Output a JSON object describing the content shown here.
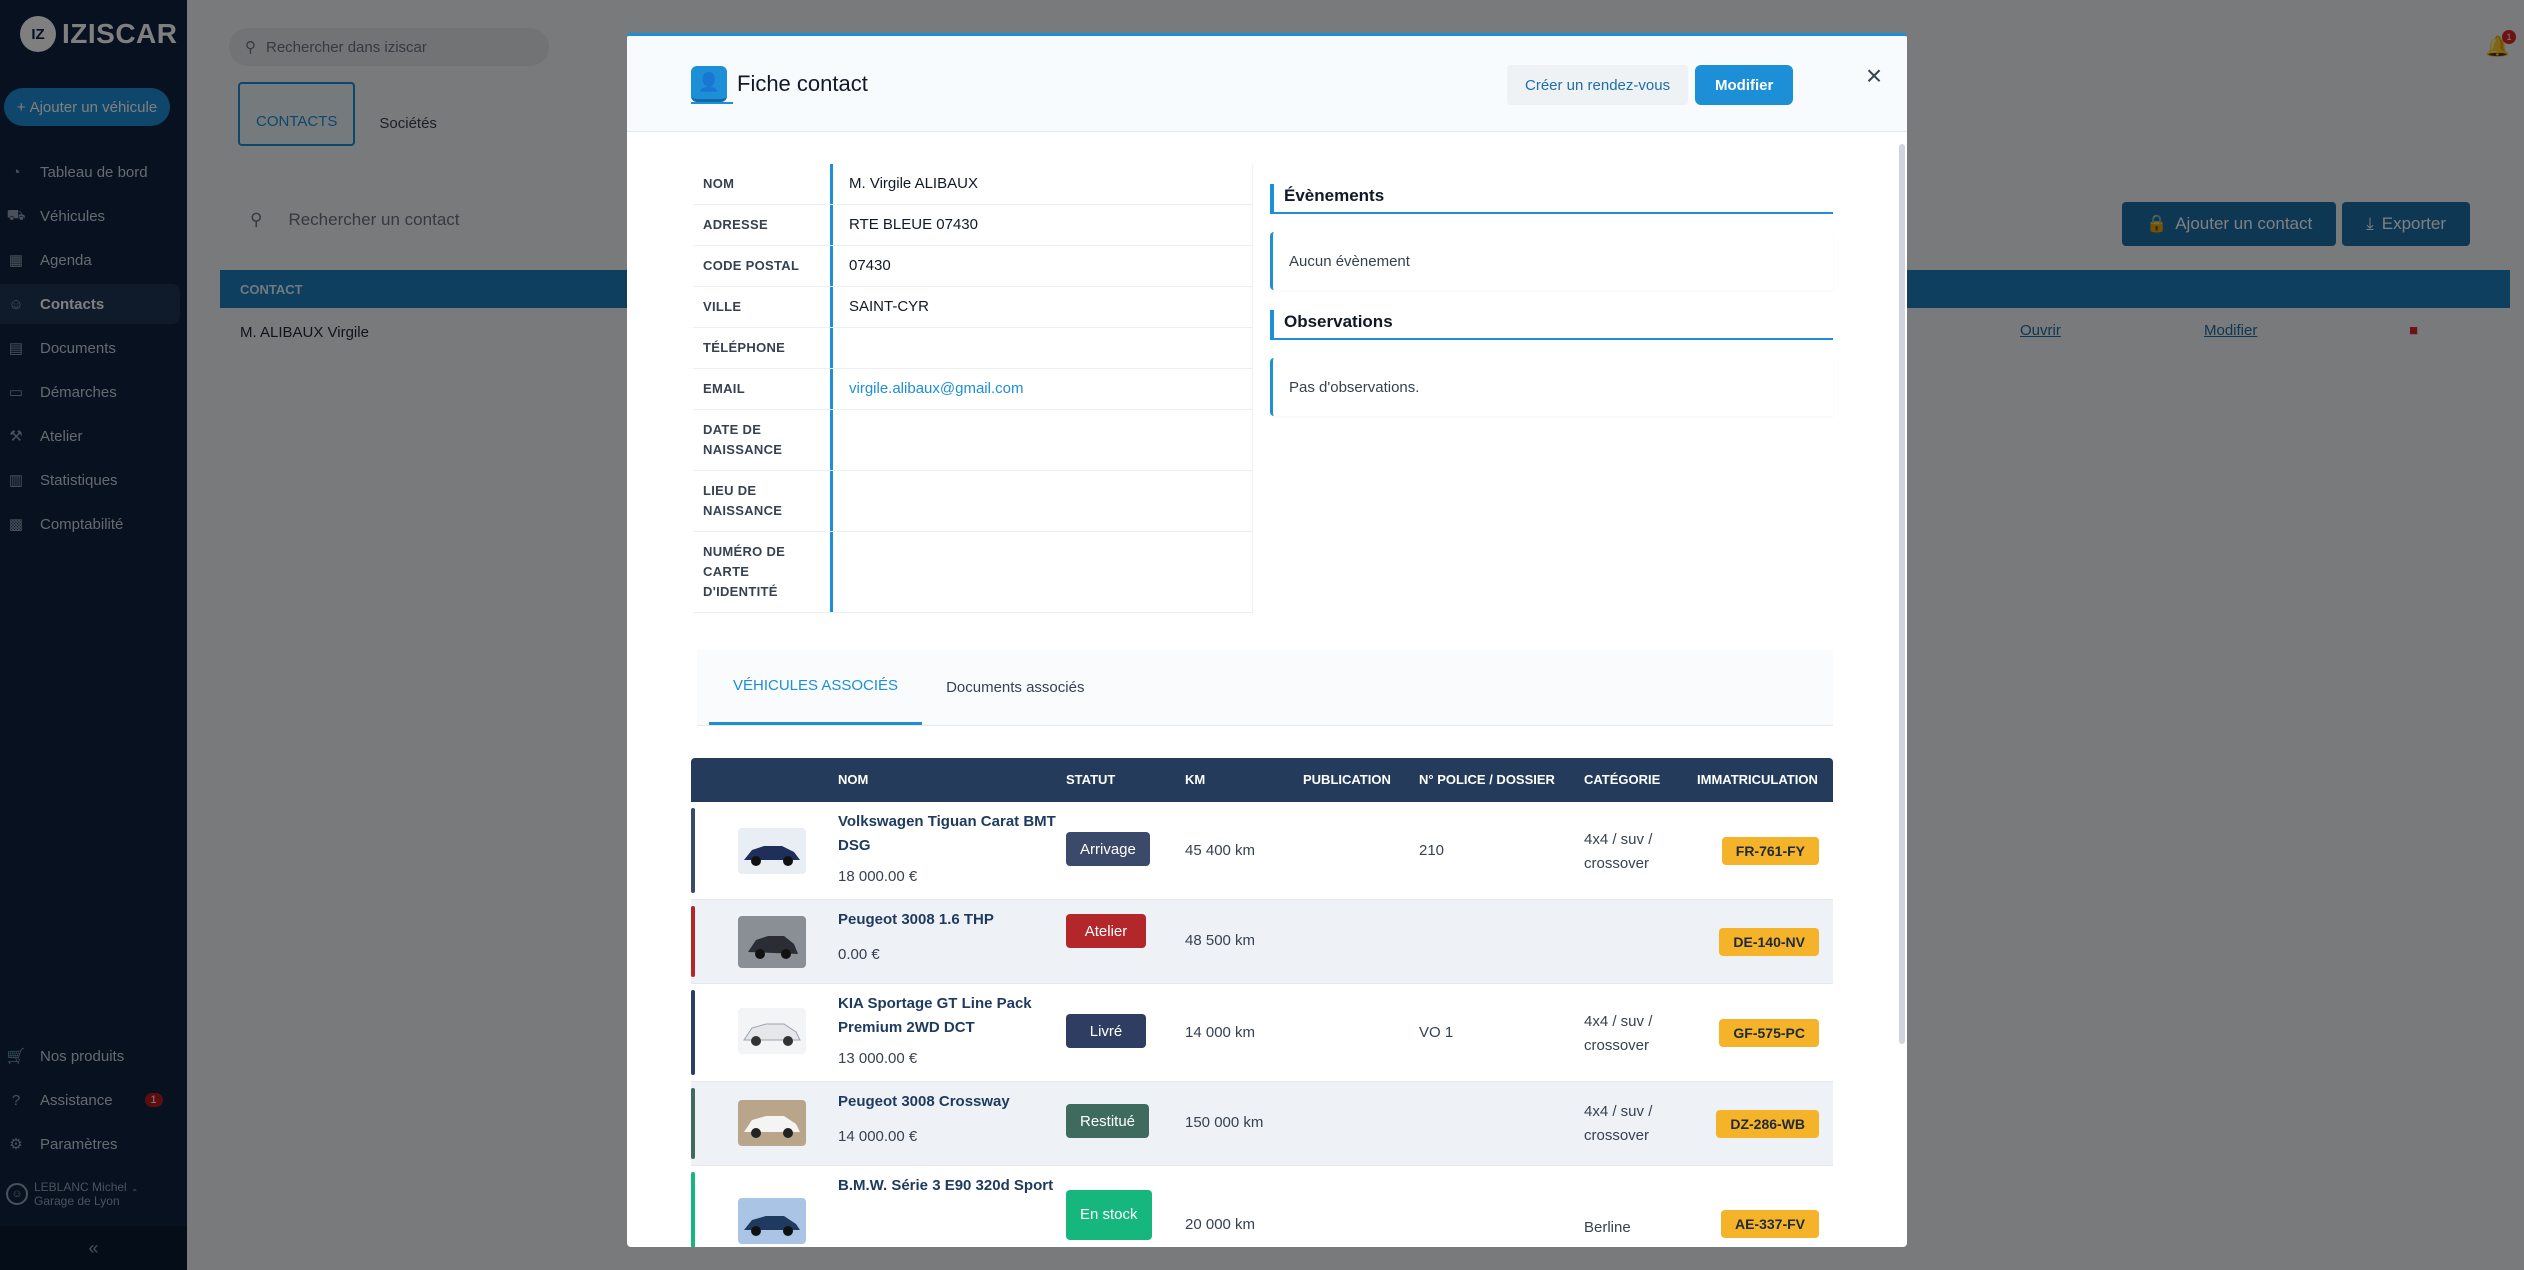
{
  "app": {
    "logo_badge": "IZ",
    "logo_text": "IZISCAR",
    "add_vehicle": "Ajouter un véhicule",
    "global_search_placeholder": "Rechercher dans iziscar",
    "bell_count": "1"
  },
  "sidebar": {
    "items": [
      {
        "label": "Tableau de bord",
        "icon": "dashboard-icon"
      },
      {
        "label": "Véhicules",
        "icon": "car-icon"
      },
      {
        "label": "Agenda",
        "icon": "calendar-icon"
      },
      {
        "label": "Contacts",
        "icon": "user-icon"
      },
      {
        "label": "Documents",
        "icon": "document-icon"
      },
      {
        "label": "Démarches",
        "icon": "folder-icon"
      },
      {
        "label": "Atelier",
        "icon": "wrench-icon"
      },
      {
        "label": "Statistiques",
        "icon": "chart-icon"
      },
      {
        "label": "Comptabilité",
        "icon": "calculator-icon"
      }
    ],
    "bottom": [
      {
        "label": "Nos produits",
        "icon": "cart-icon"
      },
      {
        "label": "Assistance",
        "icon": "help-icon",
        "badge": "1"
      },
      {
        "label": "Paramètres",
        "icon": "gear-icon"
      }
    ],
    "user_name": "LEBLANC Michel",
    "user_company": "Garage de Lyon",
    "collapse": "«"
  },
  "page": {
    "tabs": [
      "CONTACTS",
      "Sociétés"
    ],
    "search_placeholder": "Rechercher un contact",
    "add_contact": "Ajouter un contact",
    "export": "Exporter",
    "list_header": "CONTACT",
    "row_name": "M. ALIBAUX Virgile",
    "row_open": "Ouvrir",
    "row_edit": "Modifier"
  },
  "modal": {
    "title": "Fiche contact",
    "rdv_button": "Créer un rendez-vous",
    "edit_button": "Modifier",
    "fields": [
      {
        "label": "NOM",
        "value": "M. Virgile ALIBAUX"
      },
      {
        "label": "ADRESSE",
        "value": "RTE BLEUE 07430"
      },
      {
        "label": "CODE POSTAL",
        "value": "07430"
      },
      {
        "label": "VILLE",
        "value": "SAINT-CYR"
      },
      {
        "label": "TÉLÉPHONE",
        "value": ""
      },
      {
        "label": "EMAIL",
        "value": "virgile.alibaux@gmail.com"
      },
      {
        "label": "DATE DE NAISSANCE",
        "value": ""
      },
      {
        "label": "LIEU DE NAISSANCE",
        "value": ""
      },
      {
        "label": "NUMÉRO DE CARTE D'IDENTITÉ",
        "value": ""
      }
    ],
    "events_title": "Évènements",
    "events_empty": "Aucun évènement",
    "observations_title": "Observations",
    "observations_empty": "Pas d'observations.",
    "assoc_tabs": [
      "VÉHICULES ASSOCIÉS",
      "Documents associés"
    ],
    "vehicles_columns": [
      "NOM",
      "STATUT",
      "KM",
      "PUBLICATION",
      "N° POLICE / DOSSIER",
      "CATÉGORIE",
      "IMMATRICULATION"
    ],
    "vehicles": [
      {
        "name": "Volkswagen Tiguan Carat BMT DSG",
        "price": "18 000.00 €",
        "status": "Arrivage",
        "status_color": "#3b4a6b",
        "km": "45 400 km",
        "police": "210",
        "category": "4x4 / suv / crossover",
        "plate": "FR-761-FY",
        "bar_color": "#3b4a6b"
      },
      {
        "name": "Peugeot 3008 1.6 THP",
        "price": "0.00 €",
        "status": "Atelier",
        "status_color": "#b3262a",
        "km": "48 500 km",
        "police": "",
        "category": "",
        "plate": "DE-140-NV",
        "bar_color": "#b3262a"
      },
      {
        "name": "KIA Sportage GT Line Pack Premium 2WD DCT",
        "price": "13 000.00 €",
        "status": "Livré",
        "status_color": "#2f3d63",
        "km": "14 000 km",
        "police": "VO 1",
        "category": "4x4 / suv / crossover",
        "plate": "GF-575-PC",
        "bar_color": "#2f3d63"
      },
      {
        "name": "Peugeot 3008 Crossway",
        "price": "14 000.00 €",
        "status": "Restitué",
        "status_color": "#3f6b5e",
        "km": "150 000 km",
        "police": "",
        "category": "4x4 / suv / crossover",
        "plate": "DZ-286-WB",
        "bar_color": "#3f6b5e"
      },
      {
        "name": "B.M.W. Série 3 E90 320d Sport",
        "price": "",
        "status": "En stock",
        "status_color": "#16b67f",
        "km": "20 000 km",
        "police": "",
        "category": "Berline",
        "plate": "AE-337-FV",
        "bar_color": "#16b67f"
      }
    ]
  }
}
